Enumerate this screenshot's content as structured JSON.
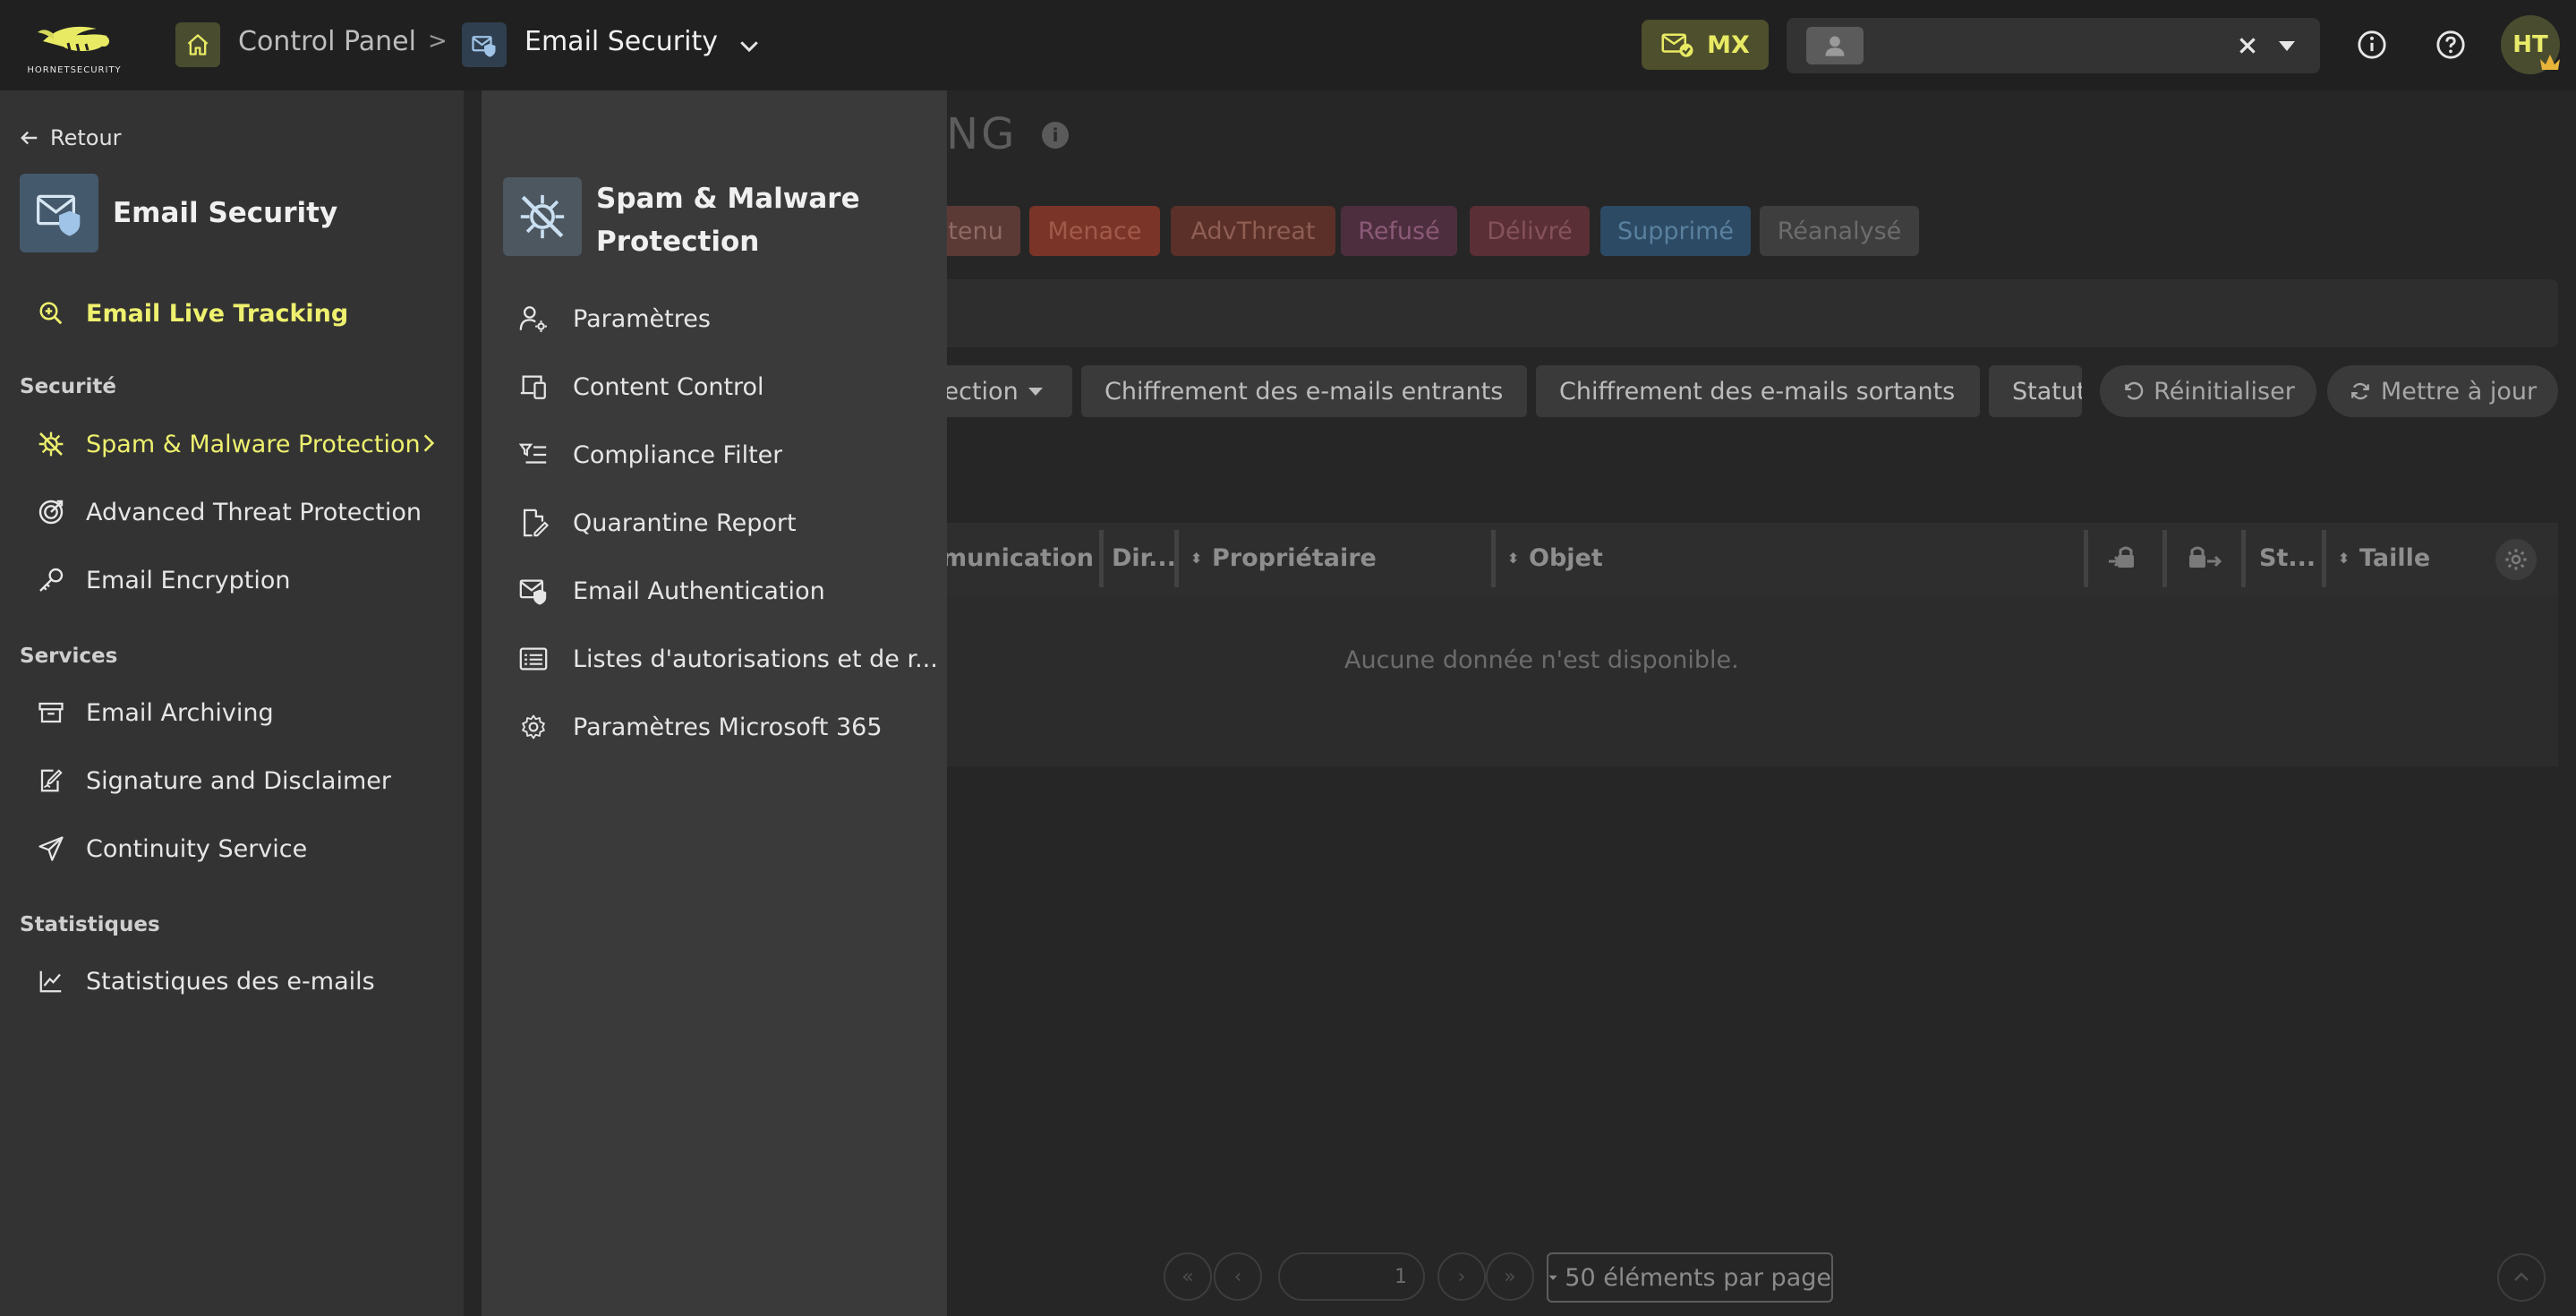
{
  "topbar": {
    "logo_text": "HORNETSECURITY",
    "breadcrumb_root": "Control Panel",
    "breadcrumb_separator": ">",
    "breadcrumb_current": "Email Security",
    "mx_label": "MX",
    "user_initials": "HT"
  },
  "background_page": {
    "title_fragment": "ING",
    "status_chips": [
      {
        "label": "tenu",
        "bg": "#5b3a36",
        "fg": "#8f6a63"
      },
      {
        "label": "Menace",
        "bg": "#7a3428",
        "fg": "#a15a4a"
      },
      {
        "label": "AdvThreat",
        "bg": "#5a3028",
        "fg": "#8e5d53"
      },
      {
        "label": "Refusé",
        "bg": "#4d2e3e",
        "fg": "#8a5a77"
      },
      {
        "label": "Délivré",
        "bg": "#5a2f36",
        "fg": "#85525c"
      },
      {
        "label": "Supprimé",
        "bg": "#2d4a64",
        "fg": "#59809f"
      },
      {
        "label": "Réanalysé",
        "bg": "#3e3e3e",
        "fg": "#6c6c6c"
      }
    ],
    "filters": {
      "direction": "rection",
      "incoming_encryption": "Chiffrement des e-mails entrants",
      "outgoing_encryption": "Chiffrement des e-mails sortants",
      "status": "Statut"
    },
    "reset_label": "Réinitialiser",
    "refresh_label": "Mettre à jour",
    "columns": {
      "communication": "munication",
      "direction": "Dir...",
      "owner": "Propriétaire",
      "subject": "Objet",
      "status": "St...",
      "size": "Taille"
    },
    "empty_message": "Aucune donnée n'est disponible.",
    "pagination": {
      "current_page": "1",
      "per_page_label": "50 éléments par page"
    }
  },
  "sidebar": {
    "back_label": "Retour",
    "header_title": "Email Security",
    "live_tracking": "Email Live Tracking",
    "sections": {
      "security": "Securité",
      "services": "Services",
      "statistics": "Statistiques"
    },
    "items": {
      "spam": "Spam & Malware Protection",
      "atp": "Advanced Threat Protection",
      "encryption": "Email Encryption",
      "archiving": "Email Archiving",
      "signature": "Signature and Disclaimer",
      "continuity": "Continuity Service",
      "stats": "Statistiques des e-mails"
    }
  },
  "submenu": {
    "title": "Spam & Malware Protection",
    "items": [
      {
        "label": "Paramètres",
        "icon": "user-gear-icon"
      },
      {
        "label": "Content Control",
        "icon": "devices-icon"
      },
      {
        "label": "Compliance Filter",
        "icon": "filter-list-icon"
      },
      {
        "label": "Quarantine Report",
        "icon": "document-edit-icon"
      },
      {
        "label": "Email Authentication",
        "icon": "mail-shield-icon"
      },
      {
        "label": "Listes d'autorisations et de r...",
        "icon": "list-icon"
      },
      {
        "label": "Paramètres Microsoft 365",
        "icon": "gear-icon"
      }
    ]
  },
  "colors": {
    "accent_yellow": "#eef06e",
    "sidebar_bg": "#333333",
    "submenu_bg": "#3a3a3a",
    "topbar_bg": "#202020"
  }
}
